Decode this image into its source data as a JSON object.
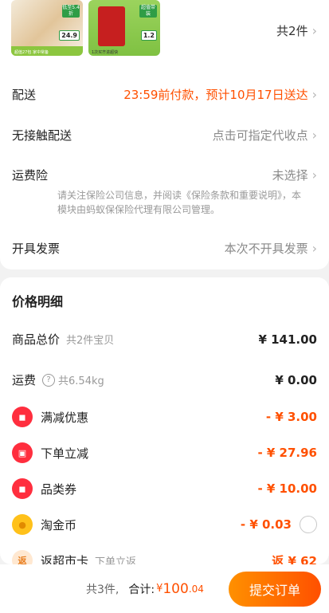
{
  "order": {
    "thumb1": {
      "tag": "低至5.4折",
      "price": "24.9",
      "caption": "超值27包 家中常备"
    },
    "thumb2": {
      "tag": "超值带装",
      "price": "1.2",
      "caption": "1次买齐进超快"
    },
    "count_label": "共2件",
    "delivery_label": "配送",
    "delivery_value": "23:59前付款，预计10月17日送达",
    "contactless_label": "无接触配送",
    "contactless_value": "点击可指定代收点",
    "insurance_label": "运费险",
    "insurance_value": "未选择",
    "insurance_note": "请关注保险公司信息，并阅读《保险条款和重要说明》，本模块由蚂蚁保保险代理有限公司管理。",
    "invoice_label": "开具发票",
    "invoice_value": "本次不开具发票"
  },
  "price": {
    "title": "价格明细",
    "goods_label": "商品总价",
    "goods_sub": "共2件宝贝",
    "goods_value": "¥ 141.00",
    "shipping_label": "运费",
    "shipping_sub": "共6.54kg",
    "shipping_value": "¥ 0.00",
    "discount1_label": "满减优惠",
    "discount1_value": "- ¥ 3.00",
    "discount2_label": "下单立减",
    "discount2_value": "- ¥ 27.96",
    "coupon_label": "品类券",
    "coupon_value": "- ¥ 10.00",
    "coin_label": "淘金币",
    "coin_value": "- ¥ 0.03",
    "card_label": "返超市卡",
    "card_sub": "下单立返",
    "card_value": "返 ¥ 62"
  },
  "footer": {
    "count": "共3件,",
    "total_label": "合计:",
    "currency": "¥",
    "total_int": "100",
    "total_dec": ".04",
    "submit": "提交订单"
  },
  "icons": {
    "chevron": "chevron-right-icon",
    "ticket": "ticket-icon",
    "coin": "coin-icon",
    "return": "return-icon",
    "help": "help-circle-icon"
  },
  "colors": {
    "accent": "#ff5000",
    "button_start": "#ff9000",
    "button_end": "#ff5000"
  }
}
